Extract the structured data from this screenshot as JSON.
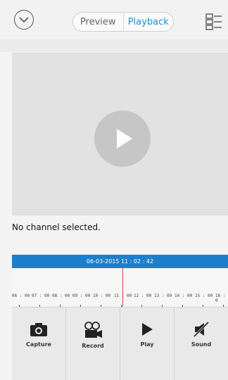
{
  "header": {
    "back_icon": "chevron-down-circle-icon",
    "tabs": [
      {
        "label": "Preview",
        "selected": false
      },
      {
        "label": "Playback",
        "selected": true
      }
    ],
    "menu_icon": "channel-list-icon",
    "accent_color": "#1e8fd8"
  },
  "player": {
    "play_icon": "play-icon",
    "status_text": "No channel selected."
  },
  "timeline": {
    "current_time": "06-03-2015 11 : 02 : 42",
    "bar_color": "#1c7fcc",
    "cursor_color": "#d9413b",
    "hour_labels": [
      "06 : 00",
      "07 : 00",
      "08 : 00",
      "09 : 00",
      "10 : 00",
      "11 : 00",
      "12 : 00",
      "13 : 00",
      "14 : 00",
      "15 : 00",
      "16 : 0"
    ]
  },
  "toolbar": {
    "capture_label": "Capture",
    "record_label": "Record",
    "play_label": "Play",
    "sound_label": "Sound",
    "icons": [
      "camera-icon",
      "record-icon",
      "play-icon",
      "sound-off-icon"
    ]
  }
}
